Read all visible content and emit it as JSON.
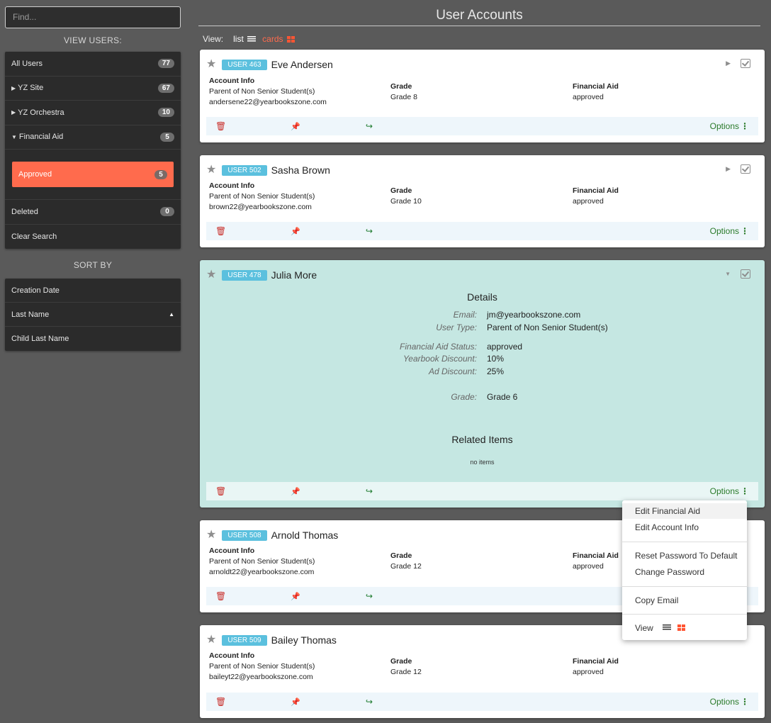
{
  "search": {
    "placeholder": "Find..."
  },
  "sidebar": {
    "view_users_title": "VIEW USERS:",
    "items": [
      {
        "label": "All Users",
        "count": "77"
      },
      {
        "label": "YZ Site",
        "count": "67"
      },
      {
        "label": "YZ Orchestra",
        "count": "10"
      },
      {
        "label": "Financial Aid",
        "count": "5"
      }
    ],
    "sub_item": {
      "label": "Approved",
      "count": "5"
    },
    "deleted": {
      "label": "Deleted",
      "count": "0"
    },
    "clear": "Clear Search",
    "sort_title": "SORT BY",
    "sort_items": [
      "Creation Date",
      "Last Name",
      "Child Last Name"
    ]
  },
  "header": {
    "title": "User Accounts"
  },
  "viewbar": {
    "label": "View:",
    "list": "list",
    "cards": "cards"
  },
  "labels": {
    "account_info": "Account Info",
    "grade": "Grade",
    "financial_aid": "Financial Aid",
    "options": "Options"
  },
  "cards": [
    {
      "id": "USER 463",
      "name": "Eve Andersen",
      "type": "Parent of Non Senior Student(s)",
      "email": "andersene22@yearbookszone.com",
      "grade": "Grade 8",
      "aid": "approved"
    },
    {
      "id": "USER 502",
      "name": "Sasha Brown",
      "type": "Parent of Non Senior Student(s)",
      "email": "brown22@yearbookszone.com",
      "grade": "Grade 10",
      "aid": "approved"
    },
    {
      "id": "USER 478",
      "name": "Julia More"
    },
    {
      "id": "USER 508",
      "name": "Arnold Thomas",
      "type": "Parent of Non Senior Student(s)",
      "email": "arnoldt22@yearbookszone.com",
      "grade": "Grade 12",
      "aid": "approved"
    },
    {
      "id": "USER 509",
      "name": "Bailey Thomas",
      "type": "Parent of Non Senior Student(s)",
      "email": "baileyt22@yearbookszone.com",
      "grade": "Grade 12",
      "aid": "approved"
    }
  ],
  "details": {
    "title": "Details",
    "email_label": "Email:",
    "email": "jm@yearbookszone.com",
    "type_label": "User Type:",
    "type": "Parent of Non Senior Student(s)",
    "aid_label": "Financial Aid Status:",
    "aid": "approved",
    "yb_label": "Yearbook Discount:",
    "yb": "10%",
    "ad_label": "Ad Discount:",
    "ad": "25%",
    "grade_label": "Grade:",
    "grade": "Grade 6",
    "related_title": "Related Items",
    "related_empty": "no items"
  },
  "menu": {
    "edit_aid": "Edit Financial Aid",
    "edit_account": "Edit Account Info",
    "reset_pw": "Reset Password To Default",
    "change_pw": "Change Password",
    "copy_email": "Copy Email",
    "view": "View"
  },
  "colors": {
    "accent": "#ff6b4d",
    "badge": "#5bc0de",
    "green": "#1e7b2e",
    "danger": "#c9302c"
  }
}
